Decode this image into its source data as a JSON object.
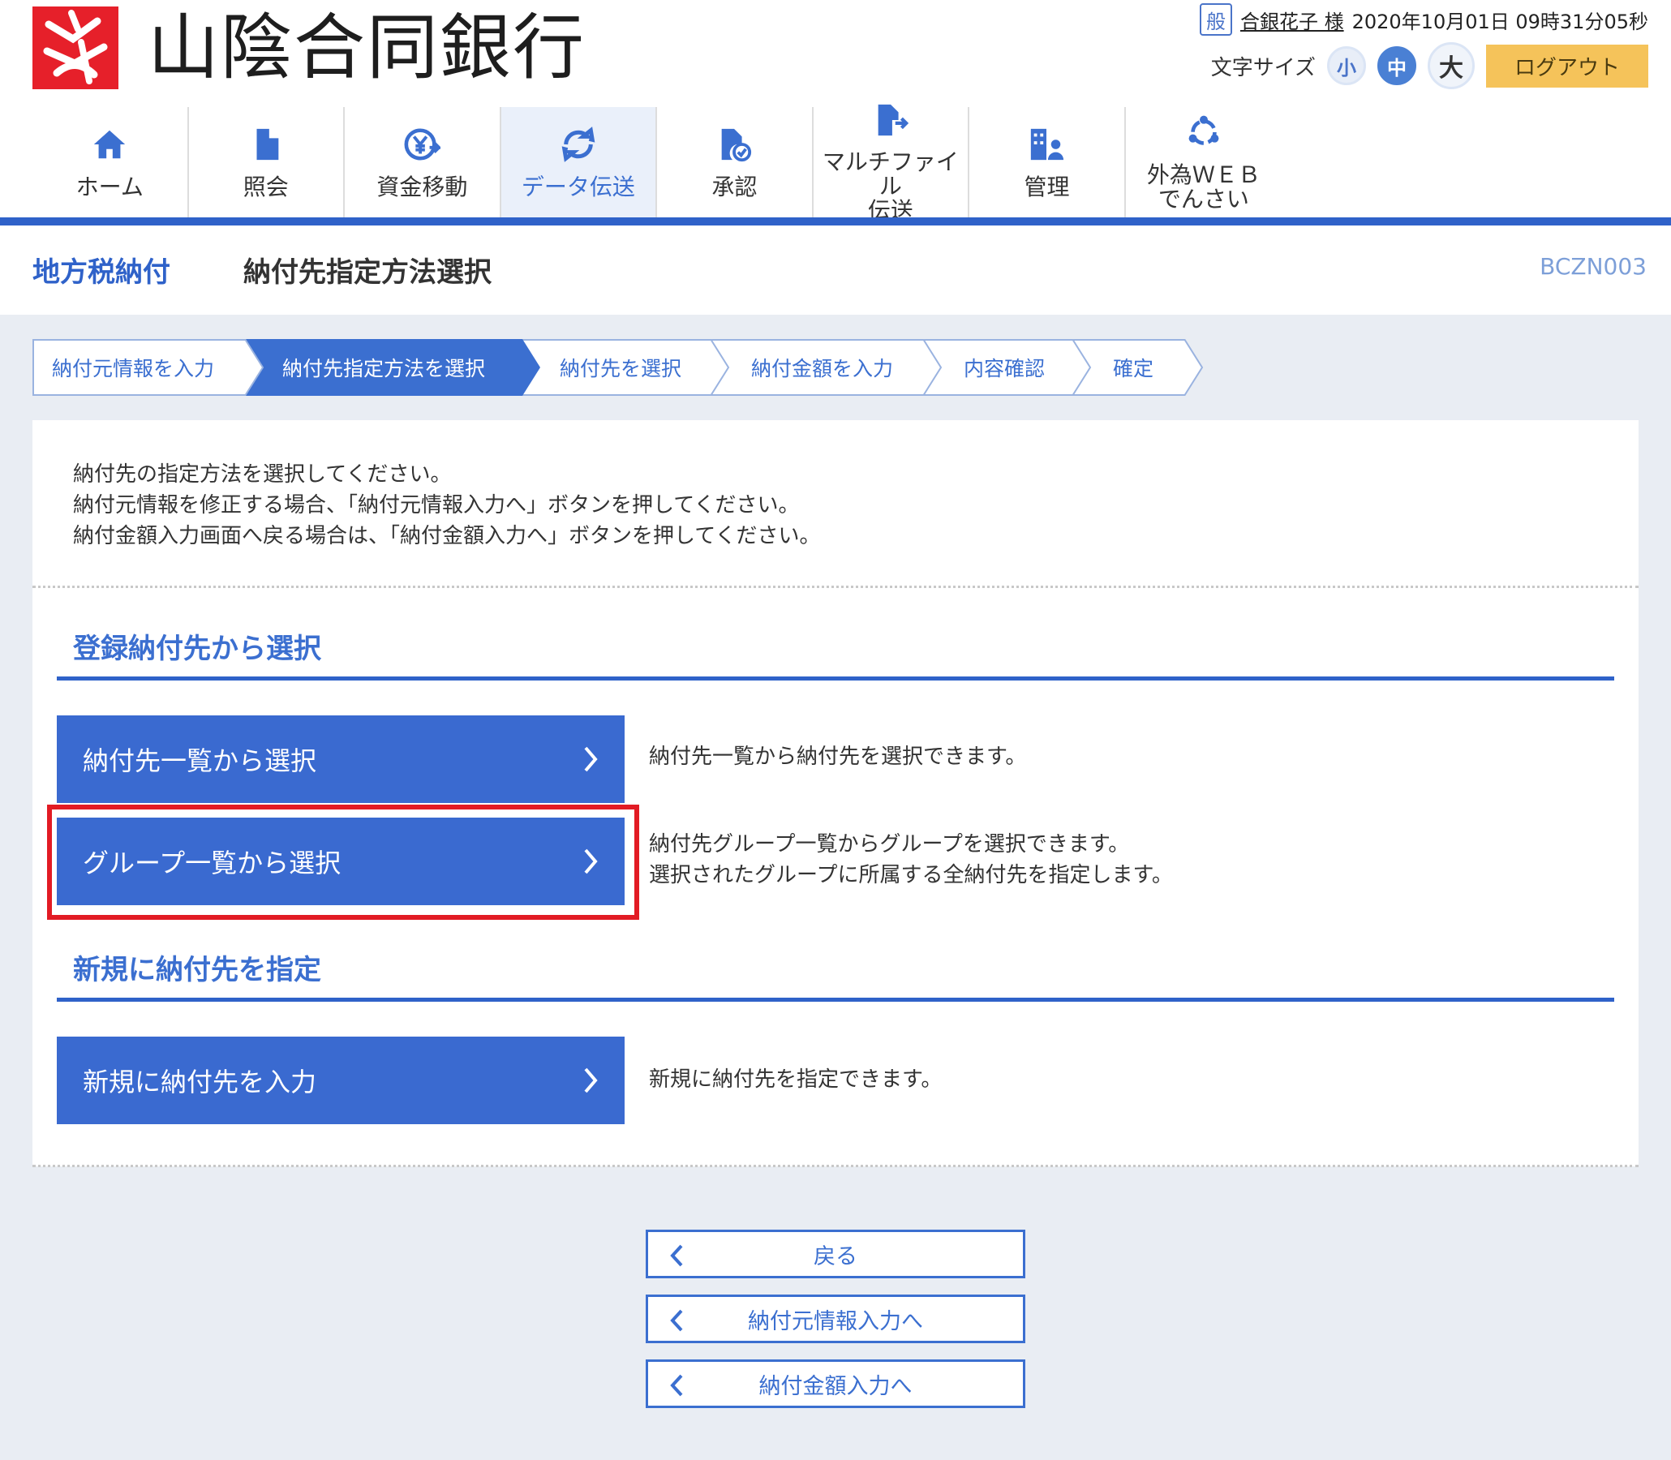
{
  "bank": {
    "name": "山陰合同銀行"
  },
  "user": {
    "badge": "般",
    "name": "合銀花子 様",
    "timestamp": "2020年10月01日 09時31分05秒"
  },
  "font_size": {
    "label": "文字サイズ",
    "small": "小",
    "medium": "中",
    "large": "大",
    "selected": "中"
  },
  "logout_label": "ログアウト",
  "nav": {
    "home": "ホーム",
    "inquiry": "照会",
    "transfer": "資金移動",
    "data": "データ伝送",
    "approval": "承認",
    "multifile": "マルチファイル\n伝送",
    "admin": "管理",
    "fx": "外為ＷＥＢ\nでんさい",
    "active": "データ伝送"
  },
  "page": {
    "category": "地方税納付",
    "title": "納付先指定方法選択",
    "code": "BCZN003"
  },
  "steps": [
    "納付元情報を入力",
    "納付先指定方法を選択",
    "納付先を選択",
    "納付金額を入力",
    "内容確認",
    "確定"
  ],
  "active_step": "納付先指定方法を選択",
  "intro": [
    "納付先の指定方法を選択してください。",
    "納付元情報を修正する場合、「納付元情報入力へ」ボタンを押してください。",
    "納付金額入力画面へ戻る場合は、「納付金額入力へ」ボタンを押してください。"
  ],
  "section1": {
    "title": "登録納付先から選択",
    "btn1": {
      "label": "納付先一覧から選択",
      "desc": "納付先一覧から納付先を選択できます。"
    },
    "btn2": {
      "label": "グループ一覧から選択",
      "desc1": "納付先グループ一覧からグループを選択できます。",
      "desc2": "選択されたグループに所属する全納付先を指定します。"
    }
  },
  "section2": {
    "title": "新規に納付先を指定",
    "btn1": {
      "label": "新規に納付先を入力",
      "desc": "新規に納付先を指定できます。"
    }
  },
  "footer": {
    "back": "戻る",
    "to_source": "納付元情報入力へ",
    "to_amount": "納付金額入力へ"
  },
  "colors": {
    "primary": "#3a6ad0",
    "highlight": "#e21b24",
    "logout": "#f5c35a",
    "logo": "#e6202a"
  }
}
